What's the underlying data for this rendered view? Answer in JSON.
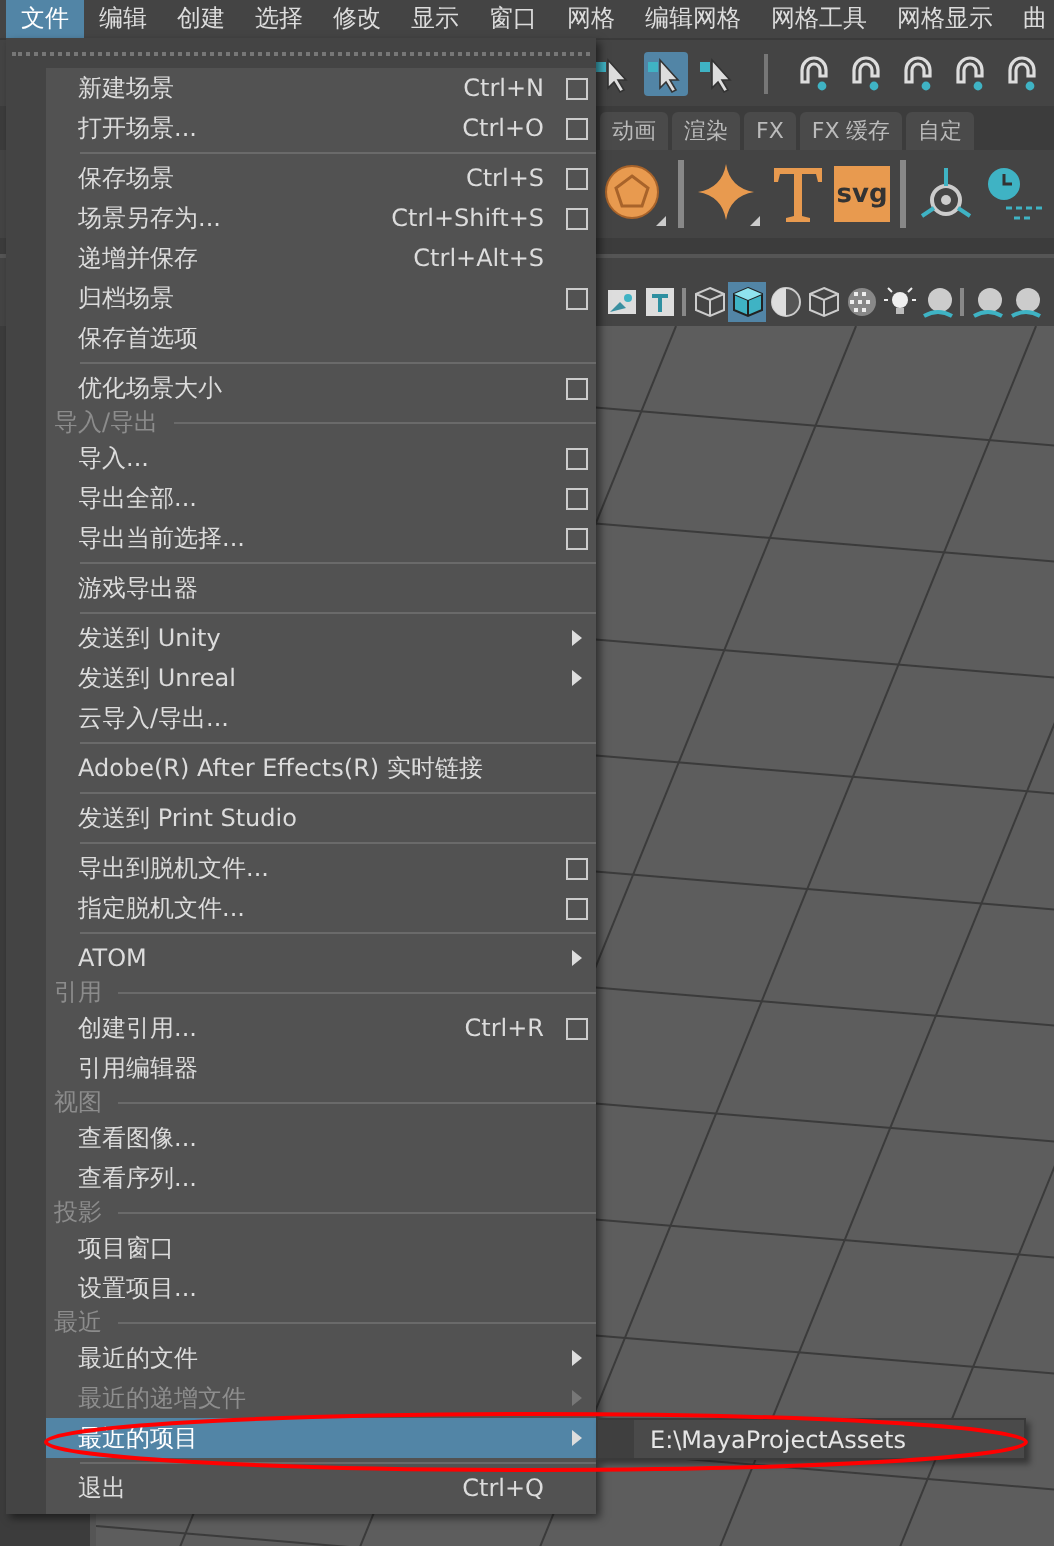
{
  "menubar": [
    {
      "label": "文件",
      "selected": true
    },
    {
      "label": "编辑",
      "selected": false
    },
    {
      "label": "创建",
      "selected": false
    },
    {
      "label": "选择",
      "selected": false
    },
    {
      "label": "修改",
      "selected": false
    },
    {
      "label": "显示",
      "selected": false
    },
    {
      "label": "窗口",
      "selected": false
    },
    {
      "label": "网格",
      "selected": false
    },
    {
      "label": "编辑网格",
      "selected": false
    },
    {
      "label": "网格工具",
      "selected": false
    },
    {
      "label": "网格显示",
      "selected": false
    },
    {
      "label": "曲",
      "selected": false
    }
  ],
  "tool_icons": [
    {
      "kind": "cursor",
      "selected": false
    },
    {
      "kind": "cursor",
      "selected": true
    },
    {
      "kind": "cursor",
      "selected": false
    },
    {
      "kind": "magnet",
      "selected": false
    },
    {
      "kind": "magnet",
      "selected": false
    },
    {
      "kind": "magnet",
      "selected": false
    },
    {
      "kind": "magnet",
      "selected": false
    },
    {
      "kind": "magnet",
      "selected": false
    }
  ],
  "shelf_tabs": [
    {
      "label": "动画"
    },
    {
      "label": "渲染"
    },
    {
      "label": "FX"
    },
    {
      "label": "FX 缓存"
    },
    {
      "label": "自定"
    }
  ],
  "shelf_icons": [
    {
      "kind": "sphere"
    },
    {
      "kind": "star"
    },
    {
      "kind": "text"
    },
    {
      "kind": "badge",
      "label": "svg"
    },
    {
      "kind": "locator"
    },
    {
      "kind": "clock"
    }
  ],
  "panel_icons": [
    {
      "kind": "image",
      "selected": false
    },
    {
      "kind": "text",
      "selected": false
    },
    {
      "kind": "wire-cube",
      "selected": false
    },
    {
      "kind": "shaded-cube",
      "selected": true
    },
    {
      "kind": "half-sphere",
      "selected": false
    },
    {
      "kind": "wire-cube",
      "selected": false
    },
    {
      "kind": "checker",
      "selected": false
    },
    {
      "kind": "light",
      "selected": false
    },
    {
      "kind": "ball",
      "selected": false
    },
    {
      "kind": "ball",
      "selected": false
    },
    {
      "kind": "ball",
      "selected": false
    }
  ],
  "file_menu": {
    "items": [
      {
        "kind": "item",
        "label": "新建场景",
        "shortcut": "Ctrl+N",
        "option_box": true,
        "selected": false,
        "disabled": false
      },
      {
        "kind": "item",
        "label": "打开场景...",
        "shortcut": "Ctrl+O",
        "option_box": true,
        "selected": false,
        "disabled": false
      },
      {
        "kind": "separator"
      },
      {
        "kind": "item",
        "label": "保存场景",
        "shortcut": "Ctrl+S",
        "option_box": true,
        "selected": false,
        "disabled": false
      },
      {
        "kind": "item",
        "label": "场景另存为...",
        "shortcut": "Ctrl+Shift+S",
        "option_box": true,
        "selected": false,
        "disabled": false
      },
      {
        "kind": "item",
        "label": "递增并保存",
        "shortcut": "Ctrl+Alt+S",
        "selected": false,
        "disabled": false
      },
      {
        "kind": "item",
        "label": "归档场景",
        "option_box": true,
        "selected": false,
        "disabled": false
      },
      {
        "kind": "item",
        "label": "保存首选项",
        "selected": false,
        "disabled": false
      },
      {
        "kind": "separator"
      },
      {
        "kind": "item",
        "label": "优化场景大小",
        "option_box": true,
        "selected": false,
        "disabled": false
      },
      {
        "kind": "section",
        "label": "导入/导出"
      },
      {
        "kind": "item",
        "label": "导入...",
        "option_box": true,
        "selected": false,
        "disabled": false
      },
      {
        "kind": "item",
        "label": "导出全部...",
        "option_box": true,
        "selected": false,
        "disabled": false
      },
      {
        "kind": "item",
        "label": "导出当前选择...",
        "option_box": true,
        "selected": false,
        "disabled": false
      },
      {
        "kind": "separator"
      },
      {
        "kind": "item",
        "label": "游戏导出器",
        "selected": false,
        "disabled": false
      },
      {
        "kind": "separator"
      },
      {
        "kind": "item",
        "label": "发送到 Unity",
        "submenu": true,
        "selected": false,
        "disabled": false
      },
      {
        "kind": "item",
        "label": "发送到 Unreal",
        "submenu": true,
        "selected": false,
        "disabled": false
      },
      {
        "kind": "item",
        "label": "云导入/导出...",
        "selected": false,
        "disabled": false
      },
      {
        "kind": "separator"
      },
      {
        "kind": "item",
        "label": "Adobe(R) After Effects(R) 实时链接",
        "selected": false,
        "disabled": false
      },
      {
        "kind": "separator"
      },
      {
        "kind": "item",
        "label": "发送到 Print Studio",
        "selected": false,
        "disabled": false
      },
      {
        "kind": "separator"
      },
      {
        "kind": "item",
        "label": "导出到脱机文件...",
        "option_box": true,
        "selected": false,
        "disabled": false
      },
      {
        "kind": "item",
        "label": "指定脱机文件...",
        "option_box": true,
        "selected": false,
        "disabled": false
      },
      {
        "kind": "separator"
      },
      {
        "kind": "item",
        "label": "ATOM",
        "submenu": true,
        "selected": false,
        "disabled": false
      },
      {
        "kind": "section",
        "label": "引用"
      },
      {
        "kind": "item",
        "label": "创建引用...",
        "shortcut": "Ctrl+R",
        "option_box": true,
        "selected": false,
        "disabled": false
      },
      {
        "kind": "item",
        "label": "引用编辑器",
        "selected": false,
        "disabled": false
      },
      {
        "kind": "section",
        "label": "视图"
      },
      {
        "kind": "item",
        "label": "查看图像...",
        "selected": false,
        "disabled": false
      },
      {
        "kind": "item",
        "label": "查看序列...",
        "selected": false,
        "disabled": false
      },
      {
        "kind": "section",
        "label": "投影"
      },
      {
        "kind": "item",
        "label": "项目窗口",
        "selected": false,
        "disabled": false
      },
      {
        "kind": "item",
        "label": "设置项目...",
        "selected": false,
        "disabled": false
      },
      {
        "kind": "section",
        "label": "最近"
      },
      {
        "kind": "item",
        "label": "最近的文件",
        "submenu": true,
        "selected": false,
        "disabled": false
      },
      {
        "kind": "item",
        "label": "最近的递增文件",
        "submenu": true,
        "selected": false,
        "disabled": true
      },
      {
        "kind": "item",
        "label": "最近的项目",
        "submenu": true,
        "selected": true,
        "disabled": false
      },
      {
        "kind": "separator"
      },
      {
        "kind": "item",
        "label": "退出",
        "shortcut": "Ctrl+Q",
        "selected": false,
        "disabled": false
      }
    ],
    "submenu": {
      "items": [
        {
          "label": "E:\\MayaProjectAssets",
          "selected": false
        }
      ]
    }
  },
  "annotations": [
    {
      "kind": "ellipse",
      "color": "#ff0000"
    }
  ]
}
